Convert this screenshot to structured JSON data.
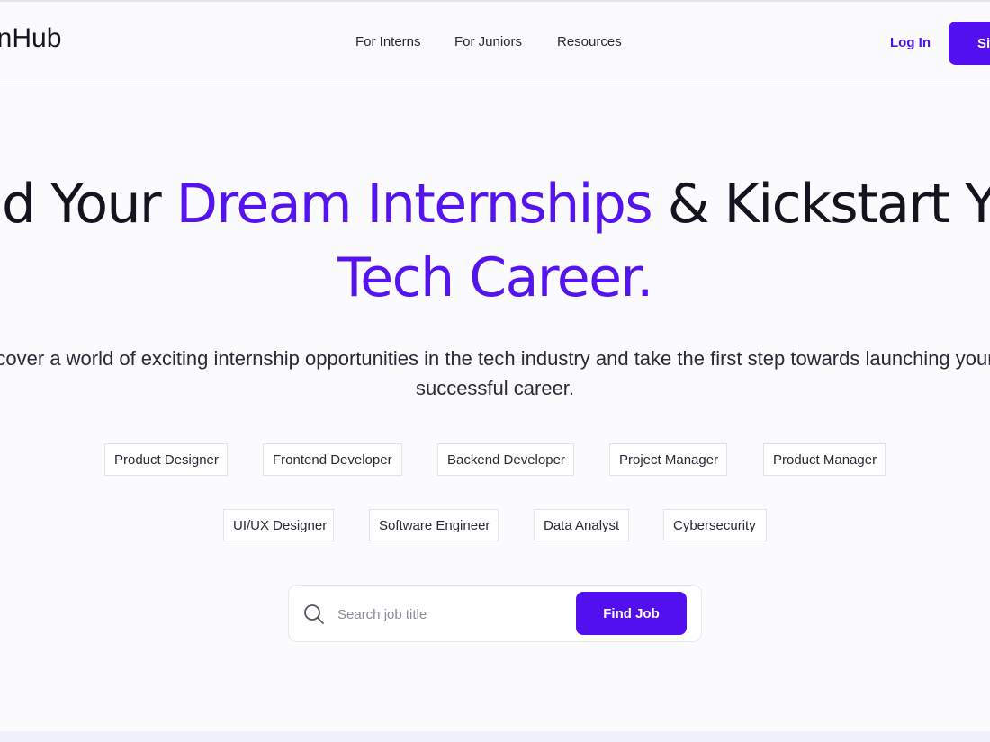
{
  "header": {
    "logo_text": "ernHub",
    "nav": [
      "For Interns",
      "For Juniors",
      "Resources"
    ],
    "login_label": "Log In",
    "signup_label": "Si"
  },
  "hero": {
    "title_part1": "nd Your ",
    "title_accent1": "Dream Internships",
    "title_part2": " & Kickstart Yo",
    "title_accent2": "Tech Career.",
    "subtitle": "cover a world of exciting internship opportunities in the tech industry and take the first step towards launching your successful career."
  },
  "categories": {
    "row1": [
      "Product Designer",
      "Frontend Developer",
      "Backend Developer",
      "Project Manager",
      "Product Manager"
    ],
    "row2": [
      "UI/UX Designer",
      "Software Engineer",
      "Data Analyst",
      "Cybersecurity"
    ]
  },
  "search": {
    "placeholder": "Search job title",
    "value": "",
    "button_label": "Find Job",
    "icon": "search-icon"
  },
  "colors": {
    "accent": "#5514ee",
    "button": "#5210f0",
    "text": "#16131f"
  }
}
